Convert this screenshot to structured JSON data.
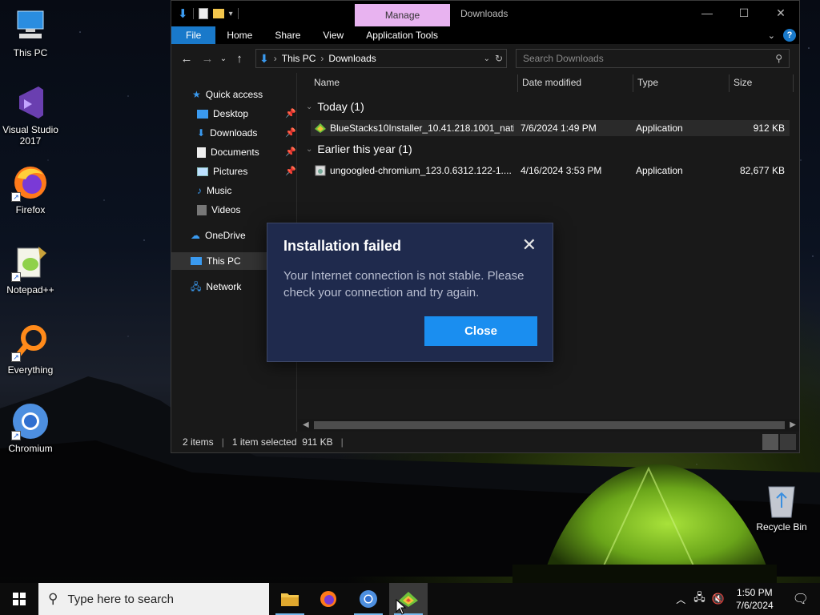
{
  "desktop": {
    "icons": [
      {
        "label": "This PC"
      },
      {
        "label": "Visual Studio\n2017"
      },
      {
        "label": "Firefox"
      },
      {
        "label": "Notepad++"
      },
      {
        "label": "Everything"
      },
      {
        "label": "Chromium"
      }
    ],
    "recycle_bin": "Recycle Bin"
  },
  "explorer": {
    "manage_tab": "Manage",
    "title": "Downloads",
    "ribbon_tabs": [
      "File",
      "Home",
      "Share",
      "View",
      "Application Tools"
    ],
    "help": "?",
    "breadcrumb": [
      "This PC",
      "Downloads"
    ],
    "search_placeholder": "Search Downloads",
    "nav": {
      "quick_access": "Quick access",
      "items": [
        "Desktop",
        "Downloads",
        "Documents",
        "Pictures",
        "Music",
        "Videos"
      ],
      "onedrive": "OneDrive",
      "this_pc": "This PC",
      "network": "Network"
    },
    "columns": [
      "Name",
      "Date modified",
      "Type",
      "Size"
    ],
    "groups": [
      {
        "title": "Today (1)",
        "files": [
          {
            "name": "BlueStacks10Installer_10.41.218.1001_nati...",
            "date": "7/6/2024 1:49 PM",
            "type": "Application",
            "size": "912 KB"
          }
        ]
      },
      {
        "title": "Earlier this year (1)",
        "files": [
          {
            "name": "ungoogled-chromium_123.0.6312.122-1....",
            "date": "4/16/2024 3:53 PM",
            "type": "Application",
            "size": "82,677 KB"
          }
        ]
      }
    ],
    "status": {
      "items": "2 items",
      "selected": "1 item selected  911 KB"
    }
  },
  "dialog": {
    "title": "Installation failed",
    "message": "Your Internet connection is not stable. Please check your connection and try again.",
    "button": "Close"
  },
  "taskbar": {
    "search_placeholder": "Type here to search",
    "time": "1:50 PM",
    "date": "7/6/2024"
  },
  "colors": {
    "accent": "#1979ca",
    "dialog_bg": "#1f2a4d",
    "dialog_button": "#1a8ef0",
    "manage_tab": "#e8b3f0"
  }
}
